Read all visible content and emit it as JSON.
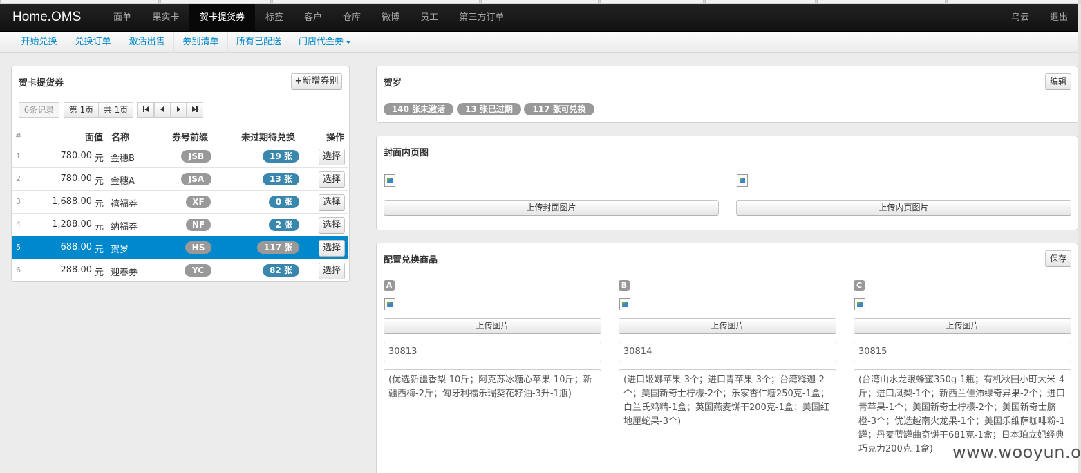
{
  "brand": "Home.OMS",
  "nav": {
    "items": [
      "面单",
      "果实卡",
      "贺卡提货券",
      "标签",
      "客户",
      "仓库",
      "微博",
      "员工",
      "第三方订单"
    ],
    "active_index": 2,
    "user": "乌云",
    "logout": "退出"
  },
  "subnav": [
    "开始兑换",
    "兑换订单",
    "激活出售",
    "券别清单",
    "所有已配送",
    "门店代金券"
  ],
  "left_panel": {
    "title": "贺卡提货券",
    "add_button": "新增券别",
    "records": "6条记录",
    "page_current": "第 1页",
    "page_total": "共 1页",
    "columns": [
      "#",
      "面值",
      "名称",
      "券号前缀",
      "未过期待兑换",
      "操作"
    ],
    "select_label": "选择",
    "rows": [
      {
        "no": "1",
        "value": "780.00",
        "unit": "元",
        "name": "金穗B",
        "prefix": "JSB",
        "pending": "19 张"
      },
      {
        "no": "2",
        "value": "780.00",
        "unit": "元",
        "name": "金穗A",
        "prefix": "JSA",
        "pending": "13 张"
      },
      {
        "no": "3",
        "value": "1,688.00",
        "unit": "元",
        "name": "禧福券",
        "prefix": "XF",
        "pending": "0 张"
      },
      {
        "no": "4",
        "value": "1,288.00",
        "unit": "元",
        "name": "纳福券",
        "prefix": "NF",
        "pending": "2 张"
      },
      {
        "no": "5",
        "value": "688.00",
        "unit": "元",
        "name": "贺岁",
        "prefix": "HS",
        "pending": "117 张"
      },
      {
        "no": "6",
        "value": "288.00",
        "unit": "元",
        "name": "迎春券",
        "prefix": "YC",
        "pending": "82 张"
      }
    ],
    "selected_row": 4
  },
  "detail": {
    "title": "贺岁",
    "edit_button": "编辑",
    "stats": [
      "140 张未激活",
      "13 张已过期",
      "117 张可兑换"
    ]
  },
  "cover": {
    "title": "封面内页图",
    "upload_cover": "上传封面图片",
    "upload_inner": "上传内页图片"
  },
  "goods": {
    "title": "配置兑换商品",
    "save_button": "保存",
    "upload_label": "上传图片",
    "items": [
      {
        "letter": "A",
        "code": "30813",
        "desc": "(优选新疆香梨-10斤；阿克苏冰糖心苹果-10斤；新疆西梅-2斤；匈牙利福乐瑞葵花籽油-3升-1瓶)"
      },
      {
        "letter": "B",
        "code": "30814",
        "desc": "(进口姬娜苹果-3个；进口青苹果-3个；台湾释迦-2个；美国新奇士柠檬-2个；乐家杏仁糖250克-1盒；白兰氏鸡精-1盒；英国燕麦饼干200克-1盒；美国红地厘蛇果-3个)"
      },
      {
        "letter": "C",
        "code": "30815",
        "desc": "(台湾山水龙眼蜂蜜350g-1瓶；有机秋田小町大米-4斤；进口凤梨-1个；新西兰佳沛绿奇异果-2个；进口青苹果-1个；美国新奇士柠檬-2个；美国新奇士脐橙-3个；优选越南火龙果-1个；美国乐维萨咖啡粉-1罐；丹麦蓝罐曲奇饼干681克-1盒；日本珀立妃经典巧克力200克-1盒)"
      }
    ]
  },
  "watermark": "www.wooyun.org",
  "colors": {
    "accent": "#0088cc",
    "badge_blue": "#3a87ad",
    "badge_gray": "#999999",
    "navbar": "#1b1b1b"
  }
}
